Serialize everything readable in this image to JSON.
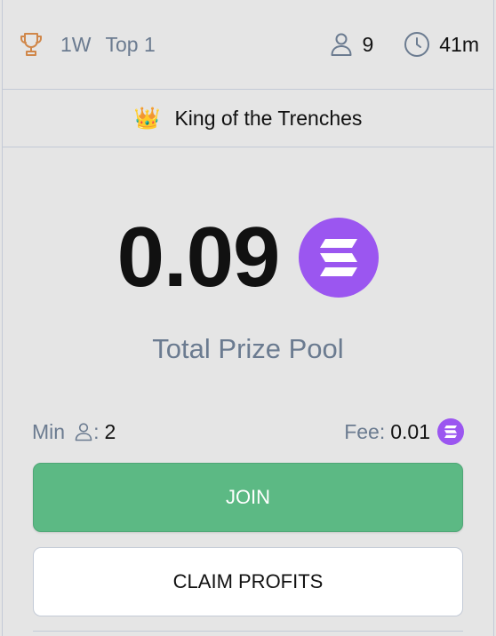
{
  "header": {
    "timeframe": "1W",
    "rank": "Top 1",
    "participants": "9",
    "time_left": "41m"
  },
  "title": {
    "emoji": "👑",
    "text": "King of the Trenches"
  },
  "pool": {
    "amount": "0.09",
    "label": "Total Prize Pool",
    "token_icon": "solana-icon"
  },
  "meta": {
    "min_label": "Min",
    "min_value": "2",
    "fee_label": "Fee:",
    "fee_value": "0.01"
  },
  "buttons": {
    "join": "JOIN",
    "claim": "CLAIM PROFITS"
  },
  "colors": {
    "background": "#e5e5e5",
    "muted_text": "#6b7b90",
    "trophy": "#d0874a",
    "solana_purple": "#9b56f0",
    "join_green": "#5cb984",
    "border": "#c3cad6"
  }
}
